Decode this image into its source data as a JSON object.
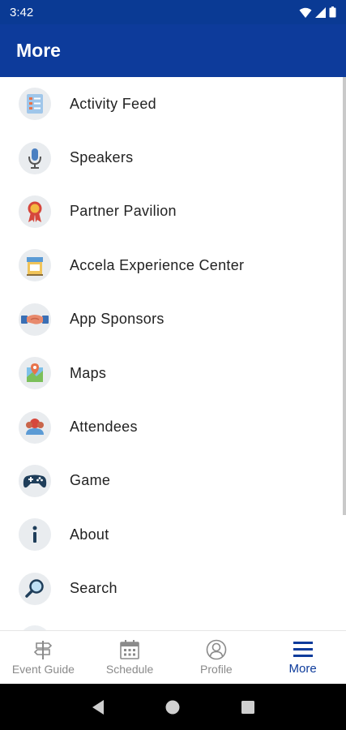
{
  "status_bar": {
    "time": "3:42"
  },
  "app_bar": {
    "title": "More"
  },
  "menu": {
    "items": [
      {
        "label": "Activity Feed",
        "icon": "activity-feed-icon"
      },
      {
        "label": "Speakers",
        "icon": "microphone-icon"
      },
      {
        "label": "Partner Pavilion",
        "icon": "ribbon-award-icon"
      },
      {
        "label": "Accela Experience Center",
        "icon": "storefront-icon"
      },
      {
        "label": "App Sponsors",
        "icon": "handshake-icon"
      },
      {
        "label": "Maps",
        "icon": "map-pin-icon"
      },
      {
        "label": "Attendees",
        "icon": "attendees-icon"
      },
      {
        "label": "Game",
        "icon": "gamepad-icon"
      },
      {
        "label": "About",
        "icon": "info-icon"
      },
      {
        "label": "Search",
        "icon": "magnifier-icon"
      }
    ]
  },
  "bottom_nav": {
    "items": [
      {
        "label": "Event Guide",
        "icon": "signpost-icon",
        "active": false
      },
      {
        "label": "Schedule",
        "icon": "calendar-icon",
        "active": false
      },
      {
        "label": "Profile",
        "icon": "profile-icon",
        "active": false
      },
      {
        "label": "More",
        "icon": "hamburger-menu-icon",
        "active": true
      }
    ]
  },
  "colors": {
    "primary": "#0d3b9b",
    "status_bar": "#0a3a94",
    "inactive_nav": "#8a8a8a",
    "icon_bg": "#e9ecef"
  }
}
